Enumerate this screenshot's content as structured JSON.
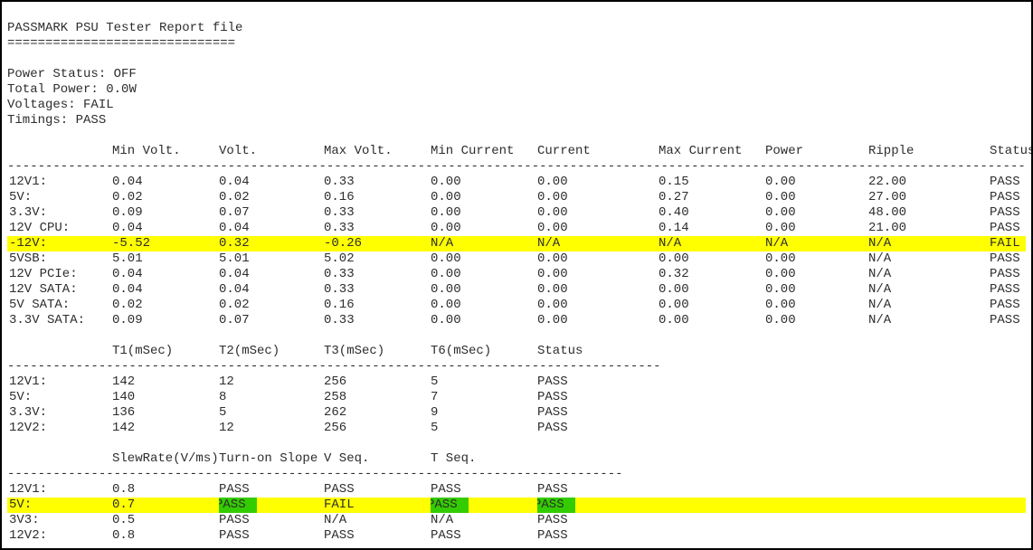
{
  "header": {
    "title": "PASSMARK PSU Tester Report file",
    "underline": "==============================",
    "power_status_label": "Power Status:",
    "power_status": "OFF",
    "total_power_label": "Total Power:",
    "total_power": "0.0W",
    "voltages_label": "Voltages:",
    "voltages": "FAIL",
    "timings_label": "Timings:",
    "timings": "PASS"
  },
  "dashes": {
    "full": "----------------------------------------------------------------------------------------------------------------------------------------------------",
    "timing": "--------------------------------------------------------------------------------------",
    "slew": "---------------------------------------------------------------------------------"
  },
  "table1": {
    "headers": {
      "minv": "Min Volt.",
      "volt": "Volt.",
      "maxv": "Max Volt.",
      "minc": "Min Current",
      "curr": "Current",
      "maxc": "Max Current",
      "power": "Power",
      "ripple": "Ripple",
      "status": "Status"
    },
    "rows": [
      {
        "label": "12V1:",
        "minv": "0.04",
        "volt": "0.04",
        "maxv": "0.33",
        "minc": "0.00",
        "curr": "0.00",
        "maxc": "0.15",
        "power": "0.00",
        "ripple": "22.00",
        "status": "PASS",
        "highlight": false
      },
      {
        "label": "5V:",
        "minv": "0.02",
        "volt": "0.02",
        "maxv": "0.16",
        "minc": "0.00",
        "curr": "0.00",
        "maxc": "0.27",
        "power": "0.00",
        "ripple": "27.00",
        "status": "PASS",
        "highlight": false
      },
      {
        "label": "3.3V:",
        "minv": "0.09",
        "volt": "0.07",
        "maxv": "0.33",
        "minc": "0.00",
        "curr": "0.00",
        "maxc": "0.40",
        "power": "0.00",
        "ripple": "48.00",
        "status": "PASS",
        "highlight": false
      },
      {
        "label": "12V CPU:",
        "minv": "0.04",
        "volt": "0.04",
        "maxv": "0.33",
        "minc": "0.00",
        "curr": "0.00",
        "maxc": "0.14",
        "power": "0.00",
        "ripple": "21.00",
        "status": "PASS",
        "highlight": false
      },
      {
        "label": "-12V:",
        "minv": "-5.52",
        "volt": "0.32",
        "maxv": "-0.26",
        "minc": "N/A",
        "curr": "N/A",
        "maxc": "N/A",
        "power": "N/A",
        "ripple": "N/A",
        "status": "FAIL",
        "highlight": true
      },
      {
        "label": "5VSB:",
        "minv": "5.01",
        "volt": "5.01",
        "maxv": "5.02",
        "minc": "0.00",
        "curr": "0.00",
        "maxc": "0.00",
        "power": "0.00",
        "ripple": "N/A",
        "status": "PASS",
        "highlight": false
      },
      {
        "label": "12V PCIe:",
        "minv": "0.04",
        "volt": "0.04",
        "maxv": "0.33",
        "minc": "0.00",
        "curr": "0.00",
        "maxc": "0.32",
        "power": "0.00",
        "ripple": "N/A",
        "status": "PASS",
        "highlight": false
      },
      {
        "label": "12V SATA:",
        "minv": "0.04",
        "volt": "0.04",
        "maxv": "0.33",
        "minc": "0.00",
        "curr": "0.00",
        "maxc": "0.00",
        "power": "0.00",
        "ripple": "N/A",
        "status": "PASS",
        "highlight": false
      },
      {
        "label": "5V SATA:",
        "minv": "0.02",
        "volt": "0.02",
        "maxv": "0.16",
        "minc": "0.00",
        "curr": "0.00",
        "maxc": "0.00",
        "power": "0.00",
        "ripple": "N/A",
        "status": "PASS",
        "highlight": false
      },
      {
        "label": "3.3V SATA:",
        "minv": "0.09",
        "volt": "0.07",
        "maxv": "0.33",
        "minc": "0.00",
        "curr": "0.00",
        "maxc": "0.00",
        "power": "0.00",
        "ripple": "N/A",
        "status": "PASS",
        "highlight": false
      }
    ]
  },
  "table2": {
    "headers": {
      "t1": "T1(mSec)",
      "t2": "T2(mSec)",
      "t3": "T3(mSec)",
      "t6": "T6(mSec)",
      "status": "Status"
    },
    "rows": [
      {
        "label": "12V1:",
        "t1": "142",
        "t2": "12",
        "t3": "256",
        "t6": "5",
        "status": "PASS"
      },
      {
        "label": "5V:",
        "t1": "140",
        "t2": "8",
        "t3": "258",
        "t6": "7",
        "status": "PASS"
      },
      {
        "label": "3.3V:",
        "t1": "136",
        "t2": "5",
        "t3": "262",
        "t6": "9",
        "status": "PASS"
      },
      {
        "label": "12V2:",
        "t1": "142",
        "t2": "12",
        "t3": "256",
        "t6": "5",
        "status": "PASS"
      }
    ]
  },
  "table3": {
    "headers": {
      "slew": "SlewRate(V/ms)",
      "turn": "Turn-on Slope",
      "vseq": "V Seq.",
      "tseq": "T Seq."
    },
    "rows": [
      {
        "label": "12V1:",
        "slew": "0.8",
        "turn": "PASS",
        "vseq": "PASS",
        "tseq": "PASS",
        "extra": "PASS",
        "highlight": false
      },
      {
        "label": "5V:",
        "slew": "0.7",
        "turn": "PASS",
        "vseq": "FAIL",
        "tseq": "PASS",
        "extra": "PASS",
        "highlight": true
      },
      {
        "label": "3V3:",
        "slew": "0.5",
        "turn": "PASS",
        "vseq": "N/A",
        "tseq": "N/A",
        "extra": "PASS",
        "highlight": false
      },
      {
        "label": "12V2:",
        "slew": "0.8",
        "turn": "PASS",
        "vseq": "PASS",
        "tseq": "PASS",
        "extra": "PASS",
        "highlight": false
      }
    ]
  }
}
